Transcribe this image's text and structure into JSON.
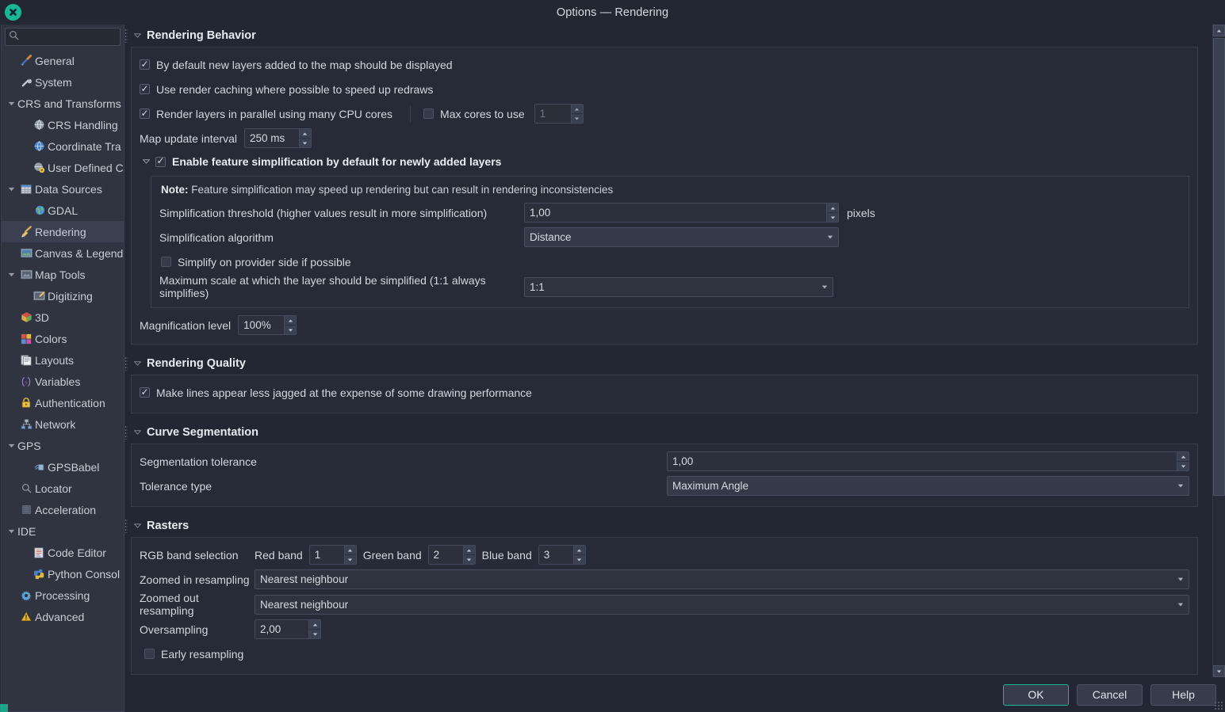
{
  "window": {
    "title": "Options — Rendering",
    "close_icon": "close-icon"
  },
  "sidebar": {
    "search": {
      "placeholder": "",
      "value": "",
      "icon": "search-icon"
    },
    "items": [
      {
        "label": "General",
        "icon": "tools-icon",
        "indent": 1,
        "twisty": "",
        "selected": false
      },
      {
        "label": "System",
        "icon": "system-icon",
        "indent": 1,
        "twisty": "",
        "selected": false
      },
      {
        "label": "CRS and Transforms",
        "icon": "",
        "indent": 0,
        "twisty": "down",
        "selected": false
      },
      {
        "label": "CRS Handling",
        "icon": "globe-grey-icon",
        "indent": 2,
        "twisty": "",
        "selected": false
      },
      {
        "label": "Coordinate Tra",
        "icon": "globe-blue-icon",
        "indent": 2,
        "twisty": "",
        "selected": false
      },
      {
        "label": "User Defined C",
        "icon": "globe-gear-icon",
        "indent": 2,
        "twisty": "",
        "selected": false
      },
      {
        "label": "Data Sources",
        "icon": "table-icon",
        "indent": 0,
        "twisty": "down",
        "selected": false
      },
      {
        "label": "GDAL",
        "icon": "earth-icon",
        "indent": 2,
        "twisty": "",
        "selected": false
      },
      {
        "label": "Rendering",
        "icon": "brush-icon",
        "indent": 1,
        "twisty": "",
        "selected": true
      },
      {
        "label": "Canvas & Legend",
        "icon": "canvas-icon",
        "indent": 1,
        "twisty": "",
        "selected": false
      },
      {
        "label": "Map Tools",
        "icon": "maptools-icon",
        "indent": 0,
        "twisty": "down",
        "selected": false
      },
      {
        "label": "Digitizing",
        "icon": "digitizing-icon",
        "indent": 2,
        "twisty": "",
        "selected": false
      },
      {
        "label": "3D",
        "icon": "cube-icon",
        "indent": 1,
        "twisty": "",
        "selected": false
      },
      {
        "label": "Colors",
        "icon": "palette-icon",
        "indent": 1,
        "twisty": "",
        "selected": false
      },
      {
        "label": "Layouts",
        "icon": "layout-icon",
        "indent": 1,
        "twisty": "",
        "selected": false
      },
      {
        "label": "Variables",
        "icon": "variables-icon",
        "indent": 1,
        "twisty": "",
        "selected": false
      },
      {
        "label": "Authentication",
        "icon": "lock-icon",
        "indent": 1,
        "twisty": "",
        "selected": false
      },
      {
        "label": "Network",
        "icon": "network-icon",
        "indent": 1,
        "twisty": "",
        "selected": false
      },
      {
        "label": "GPS",
        "icon": "",
        "indent": 0,
        "twisty": "down",
        "selected": false
      },
      {
        "label": "GPSBabel",
        "icon": "gps-icon",
        "indent": 2,
        "twisty": "",
        "selected": false
      },
      {
        "label": "Locator",
        "icon": "search-icon",
        "indent": 1,
        "twisty": "",
        "selected": false
      },
      {
        "label": "Acceleration",
        "icon": "accel-icon",
        "indent": 1,
        "twisty": "",
        "selected": false
      },
      {
        "label": "IDE",
        "icon": "",
        "indent": 0,
        "twisty": "down",
        "selected": false
      },
      {
        "label": "Code Editor",
        "icon": "code-icon",
        "indent": 2,
        "twisty": "",
        "selected": false
      },
      {
        "label": "Python Consol",
        "icon": "python-icon",
        "indent": 2,
        "twisty": "",
        "selected": false
      },
      {
        "label": "Processing",
        "icon": "gear-icon",
        "indent": 1,
        "twisty": "",
        "selected": false
      },
      {
        "label": "Advanced",
        "icon": "warning-icon",
        "indent": 1,
        "twisty": "",
        "selected": false
      }
    ]
  },
  "sections": {
    "rendering_behavior": {
      "title": "Rendering Behavior",
      "checkboxes": {
        "default_display": {
          "label": "By default new layers added to the map should be displayed",
          "checked": true
        },
        "render_caching": {
          "label": "Use render caching where possible to speed up redraws",
          "checked": true
        },
        "parallel_render": {
          "label": "Render layers in parallel using many CPU cores",
          "checked": true
        },
        "max_cores": {
          "label": "Max cores to use",
          "checked": false,
          "value": "1"
        }
      },
      "map_update_interval": {
        "label": "Map update interval",
        "value": "250 ms"
      },
      "simplification": {
        "enable_label": "Enable feature simplification by default for newly added layers",
        "enable_checked": true,
        "note_prefix": "Note:",
        "note_text": " Feature simplification may speed up rendering but can result in rendering inconsistencies",
        "threshold_label": "Simplification threshold (higher values result in more simplification)",
        "threshold_value": "1,00",
        "threshold_unit": "pixels",
        "algorithm_label": "Simplification algorithm",
        "algorithm_value": "Distance",
        "provider_side_label": "Simplify on provider side if possible",
        "provider_side_checked": false,
        "max_scale_label": "Maximum scale at which the layer should be simplified (1:1 always simplifies)",
        "max_scale_value": "1:1"
      },
      "magnification": {
        "label": "Magnification level",
        "value": "100%"
      }
    },
    "rendering_quality": {
      "title": "Rendering Quality",
      "antialias": {
        "label": "Make lines appear less jagged at the expense of some drawing performance",
        "checked": true
      }
    },
    "curve_segmentation": {
      "title": "Curve Segmentation",
      "tolerance": {
        "label": "Segmentation tolerance",
        "value": "1,00"
      },
      "tolerance_type": {
        "label": "Tolerance type",
        "value": "Maximum Angle"
      }
    },
    "rasters": {
      "title": "Rasters",
      "rgb_band_selection_label": "RGB band selection",
      "red_band": {
        "label": "Red band",
        "value": "1"
      },
      "green_band": {
        "label": "Green band",
        "value": "2"
      },
      "blue_band": {
        "label": "Blue band",
        "value": "3"
      },
      "zoomed_in": {
        "label": "Zoomed in resampling",
        "value": "Nearest neighbour"
      },
      "zoomed_out": {
        "label": "Zoomed out resampling",
        "value": "Nearest neighbour"
      },
      "oversampling": {
        "label": "Oversampling",
        "value": "2,00"
      },
      "early_resampling": {
        "label": "Early resampling",
        "checked": false
      }
    }
  },
  "footer": {
    "ok_label": "OK",
    "cancel_label": "Cancel",
    "help_label": "Help"
  },
  "colors": {
    "accent": "#18b795",
    "window_bg": "#232733",
    "panel_bg": "#272b37",
    "sidebar_bg": "#2f3440",
    "text": "#d3d7df"
  }
}
